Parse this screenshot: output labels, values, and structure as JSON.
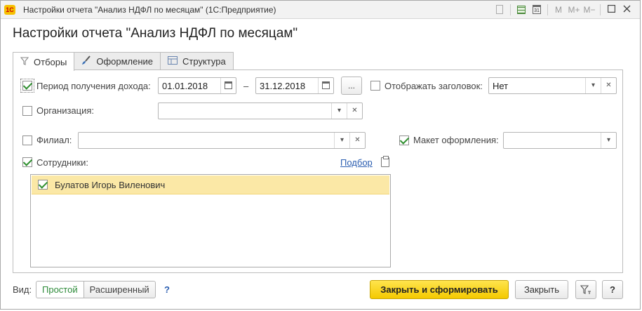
{
  "window": {
    "app_logo": "1С",
    "title": "Настройки отчета \"Анализ НДФЛ по месяцам\"  (1С:Предприятие)",
    "calendar_day": "31",
    "memory_buttons": [
      "M",
      "M+",
      "M−"
    ]
  },
  "form": {
    "title": "Настройки отчета \"Анализ НДФЛ по месяцам\""
  },
  "tabs": [
    {
      "label": "Отборы",
      "icon": "filter-icon",
      "active": true
    },
    {
      "label": "Оформление",
      "icon": "brush-icon",
      "active": false
    },
    {
      "label": "Структура",
      "icon": "structure-icon",
      "active": false
    }
  ],
  "filters": {
    "period": {
      "label": "Период получения дохода:",
      "checked": true,
      "from": "01.01.2018",
      "dash": "–",
      "to": "31.12.2018",
      "more_button": "..."
    },
    "show_header": {
      "label": "Отображать заголовок:",
      "checked": false,
      "value": "Нет"
    },
    "organization": {
      "label": "Организация:",
      "checked": false,
      "value": ""
    },
    "branch": {
      "label": "Филиал:",
      "checked": false,
      "value": ""
    },
    "layout": {
      "label": "Макет оформления:",
      "checked": true,
      "value": ""
    },
    "employees": {
      "label": "Сотрудники:",
      "checked": true,
      "pick_link": "Подбор",
      "items": [
        {
          "name": "Булатов Игорь Виленович",
          "checked": true
        }
      ]
    }
  },
  "footer": {
    "view_label": "Вид:",
    "view_options": [
      "Простой",
      "Расширенный"
    ],
    "view_selected": "Простой",
    "help": "?",
    "primary_button": "Закрыть и сформировать",
    "close_button": "Закрыть",
    "help_button": "?"
  },
  "colors": {
    "accent_green": "#2e8b3a",
    "primary_button": "#f4c900",
    "selected_row": "#fbe8a6",
    "link": "#2a5db0"
  }
}
